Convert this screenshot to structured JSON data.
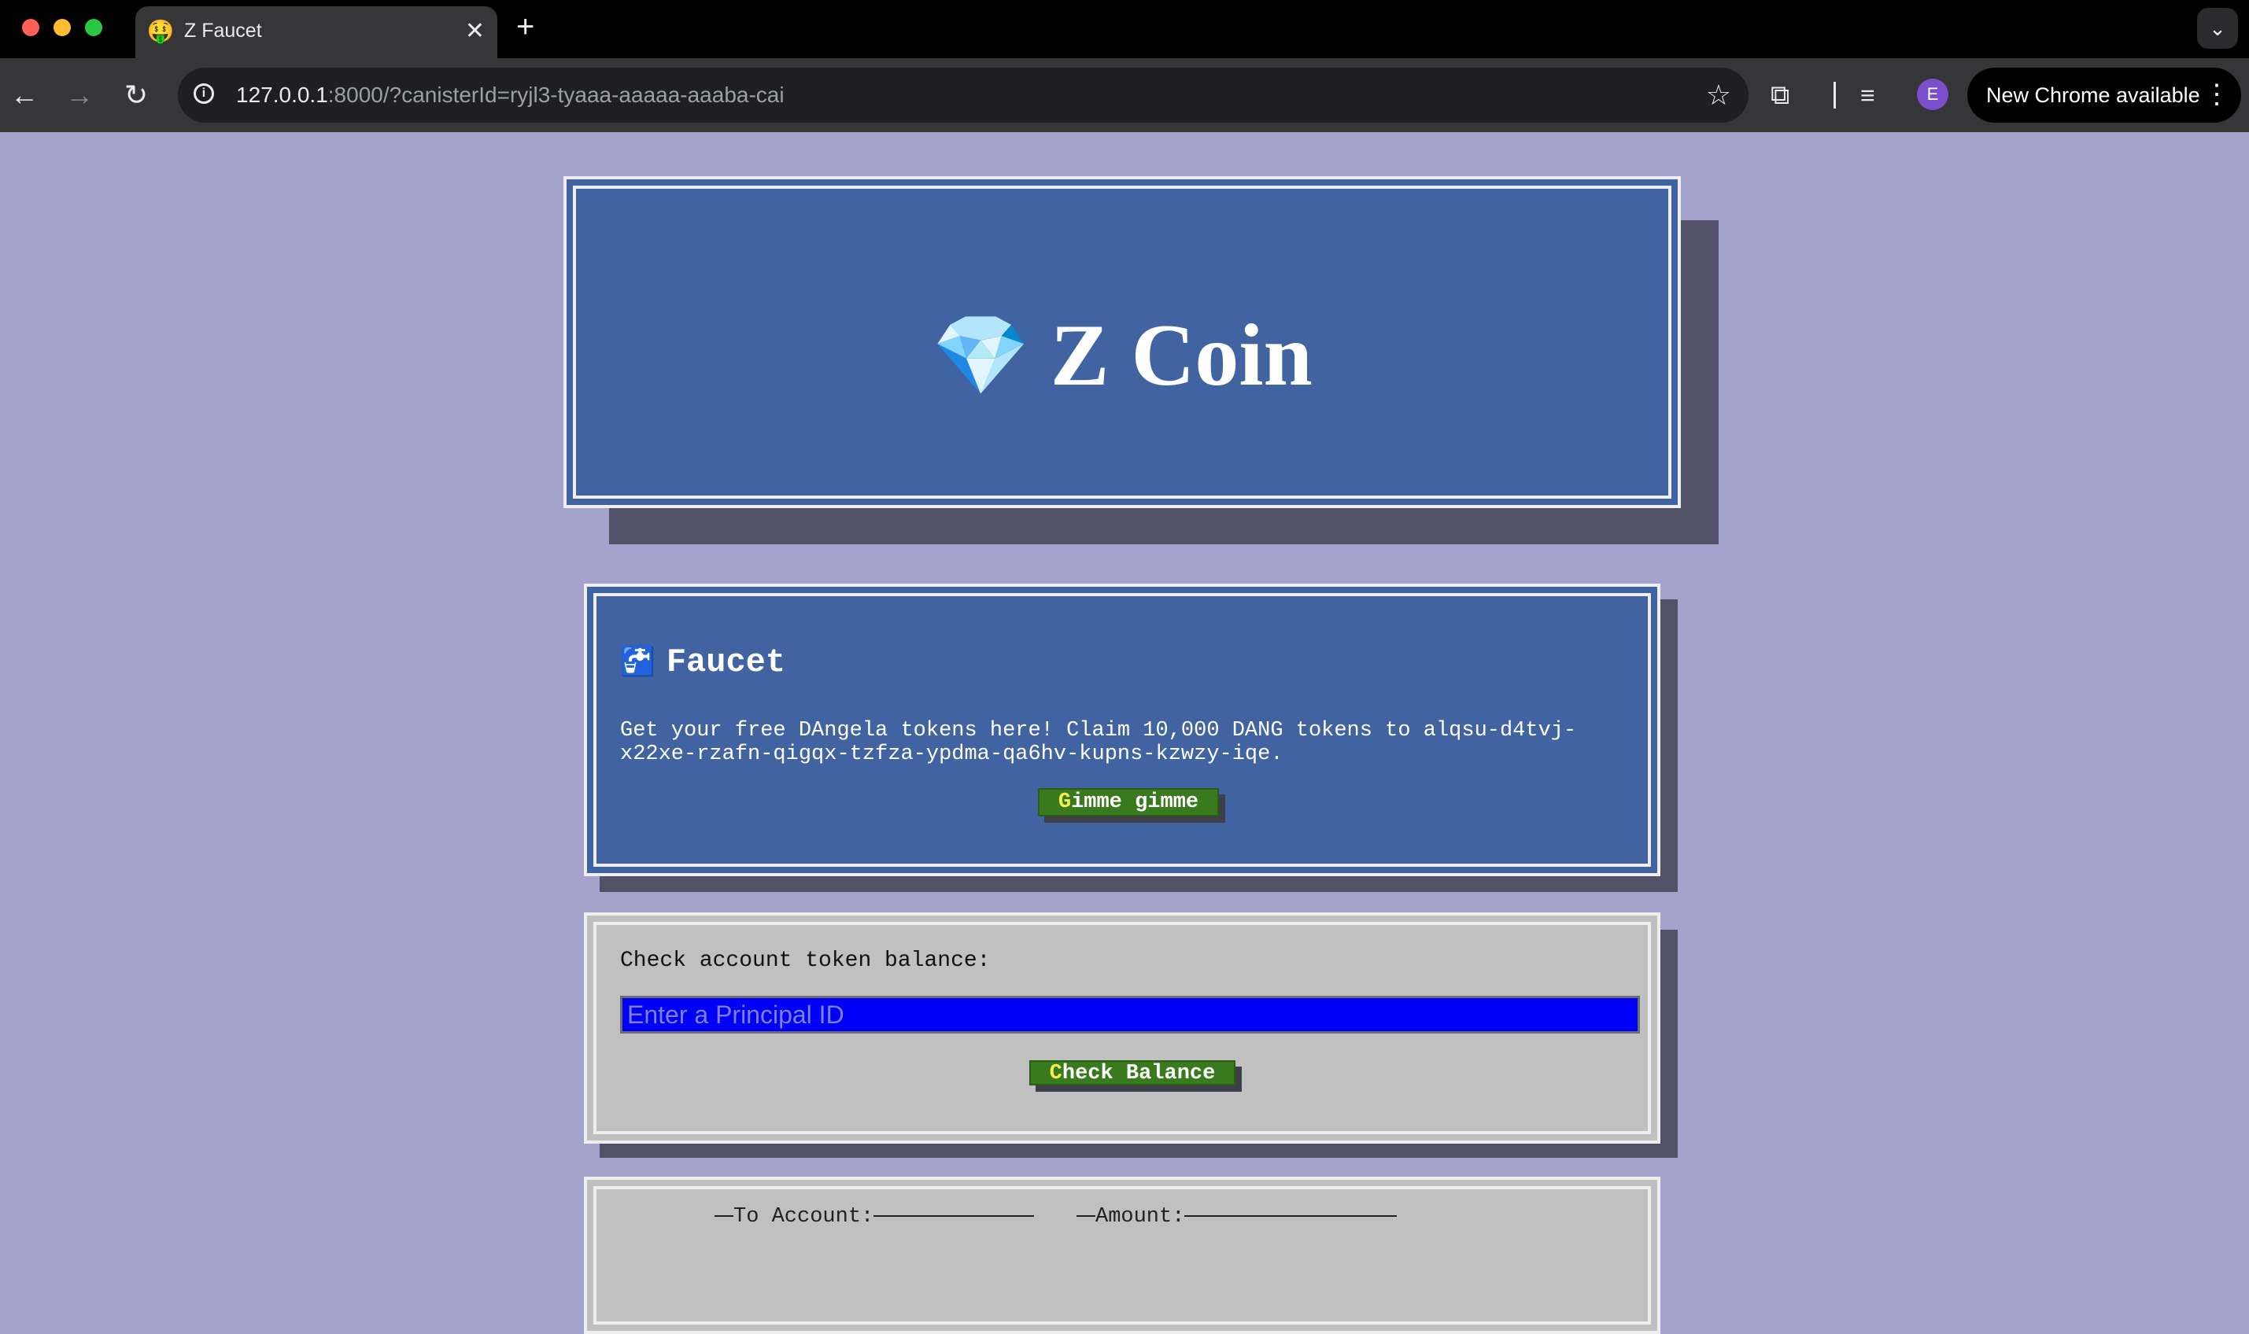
{
  "browser": {
    "tab": {
      "title": "Z Faucet",
      "favicon": "money-mouth-face-emoji"
    },
    "url": {
      "host": "127.0.0.1",
      "rest": ":8000/?canisterId=ryjl3-tyaaa-aaaaa-aaaba-cai"
    },
    "profile_initial": "E",
    "update_label": "New Chrome available"
  },
  "header": {
    "title": "Z Coin",
    "icon": "💎"
  },
  "faucet": {
    "icon": "🚰",
    "heading": "Faucet",
    "description": "Get your free DAngela tokens here! Claim 10,000 DANG tokens to alqsu-d4tvj-x22xe-rzafn-qigqx-tzfza-ypdma-qa6hv-kupns-kzwzy-iqe.",
    "button_first": "G",
    "button_rest": "imme gimme"
  },
  "balance": {
    "label": "Check account token balance:",
    "placeholder": "Enter a Principal ID",
    "button_first": "C",
    "button_rest": "heck Balance"
  },
  "transfer": {
    "to_label": "To Account:",
    "amount_label": "Amount:"
  },
  "colors": {
    "page_bg": "#a4a3cc",
    "panel_blue": "#4163a2",
    "panel_gray": "#c0c0c0",
    "button_green": "#3a7a1e",
    "input_blue": "#0000f8"
  }
}
